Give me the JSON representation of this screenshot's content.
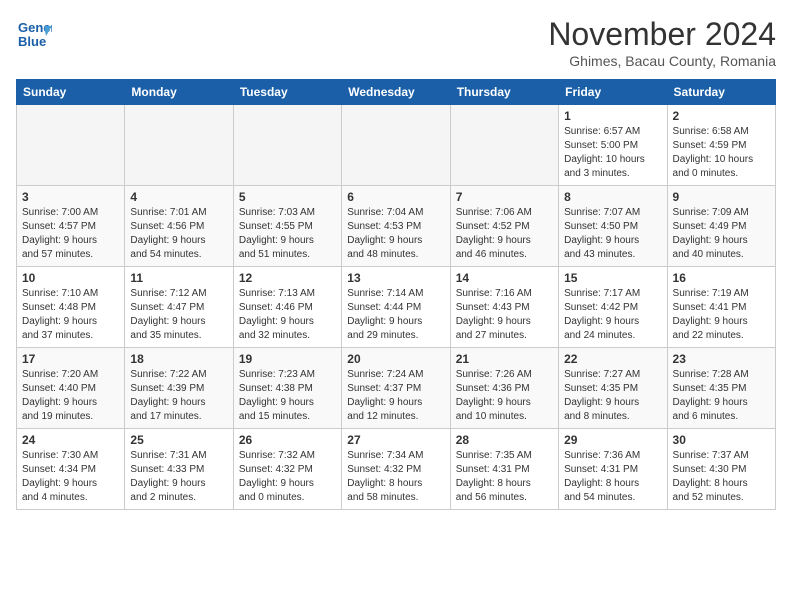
{
  "header": {
    "logo_line1": "General",
    "logo_line2": "Blue",
    "month": "November 2024",
    "location": "Ghimes, Bacau County, Romania"
  },
  "weekdays": [
    "Sunday",
    "Monday",
    "Tuesday",
    "Wednesday",
    "Thursday",
    "Friday",
    "Saturday"
  ],
  "weeks": [
    [
      {
        "day": "",
        "info": ""
      },
      {
        "day": "",
        "info": ""
      },
      {
        "day": "",
        "info": ""
      },
      {
        "day": "",
        "info": ""
      },
      {
        "day": "",
        "info": ""
      },
      {
        "day": "1",
        "info": "Sunrise: 6:57 AM\nSunset: 5:00 PM\nDaylight: 10 hours\nand 3 minutes."
      },
      {
        "day": "2",
        "info": "Sunrise: 6:58 AM\nSunset: 4:59 PM\nDaylight: 10 hours\nand 0 minutes."
      }
    ],
    [
      {
        "day": "3",
        "info": "Sunrise: 7:00 AM\nSunset: 4:57 PM\nDaylight: 9 hours\nand 57 minutes."
      },
      {
        "day": "4",
        "info": "Sunrise: 7:01 AM\nSunset: 4:56 PM\nDaylight: 9 hours\nand 54 minutes."
      },
      {
        "day": "5",
        "info": "Sunrise: 7:03 AM\nSunset: 4:55 PM\nDaylight: 9 hours\nand 51 minutes."
      },
      {
        "day": "6",
        "info": "Sunrise: 7:04 AM\nSunset: 4:53 PM\nDaylight: 9 hours\nand 48 minutes."
      },
      {
        "day": "7",
        "info": "Sunrise: 7:06 AM\nSunset: 4:52 PM\nDaylight: 9 hours\nand 46 minutes."
      },
      {
        "day": "8",
        "info": "Sunrise: 7:07 AM\nSunset: 4:50 PM\nDaylight: 9 hours\nand 43 minutes."
      },
      {
        "day": "9",
        "info": "Sunrise: 7:09 AM\nSunset: 4:49 PM\nDaylight: 9 hours\nand 40 minutes."
      }
    ],
    [
      {
        "day": "10",
        "info": "Sunrise: 7:10 AM\nSunset: 4:48 PM\nDaylight: 9 hours\nand 37 minutes."
      },
      {
        "day": "11",
        "info": "Sunrise: 7:12 AM\nSunset: 4:47 PM\nDaylight: 9 hours\nand 35 minutes."
      },
      {
        "day": "12",
        "info": "Sunrise: 7:13 AM\nSunset: 4:46 PM\nDaylight: 9 hours\nand 32 minutes."
      },
      {
        "day": "13",
        "info": "Sunrise: 7:14 AM\nSunset: 4:44 PM\nDaylight: 9 hours\nand 29 minutes."
      },
      {
        "day": "14",
        "info": "Sunrise: 7:16 AM\nSunset: 4:43 PM\nDaylight: 9 hours\nand 27 minutes."
      },
      {
        "day": "15",
        "info": "Sunrise: 7:17 AM\nSunset: 4:42 PM\nDaylight: 9 hours\nand 24 minutes."
      },
      {
        "day": "16",
        "info": "Sunrise: 7:19 AM\nSunset: 4:41 PM\nDaylight: 9 hours\nand 22 minutes."
      }
    ],
    [
      {
        "day": "17",
        "info": "Sunrise: 7:20 AM\nSunset: 4:40 PM\nDaylight: 9 hours\nand 19 minutes."
      },
      {
        "day": "18",
        "info": "Sunrise: 7:22 AM\nSunset: 4:39 PM\nDaylight: 9 hours\nand 17 minutes."
      },
      {
        "day": "19",
        "info": "Sunrise: 7:23 AM\nSunset: 4:38 PM\nDaylight: 9 hours\nand 15 minutes."
      },
      {
        "day": "20",
        "info": "Sunrise: 7:24 AM\nSunset: 4:37 PM\nDaylight: 9 hours\nand 12 minutes."
      },
      {
        "day": "21",
        "info": "Sunrise: 7:26 AM\nSunset: 4:36 PM\nDaylight: 9 hours\nand 10 minutes."
      },
      {
        "day": "22",
        "info": "Sunrise: 7:27 AM\nSunset: 4:35 PM\nDaylight: 9 hours\nand 8 minutes."
      },
      {
        "day": "23",
        "info": "Sunrise: 7:28 AM\nSunset: 4:35 PM\nDaylight: 9 hours\nand 6 minutes."
      }
    ],
    [
      {
        "day": "24",
        "info": "Sunrise: 7:30 AM\nSunset: 4:34 PM\nDaylight: 9 hours\nand 4 minutes."
      },
      {
        "day": "25",
        "info": "Sunrise: 7:31 AM\nSunset: 4:33 PM\nDaylight: 9 hours\nand 2 minutes."
      },
      {
        "day": "26",
        "info": "Sunrise: 7:32 AM\nSunset: 4:32 PM\nDaylight: 9 hours\nand 0 minutes."
      },
      {
        "day": "27",
        "info": "Sunrise: 7:34 AM\nSunset: 4:32 PM\nDaylight: 8 hours\nand 58 minutes."
      },
      {
        "day": "28",
        "info": "Sunrise: 7:35 AM\nSunset: 4:31 PM\nDaylight: 8 hours\nand 56 minutes."
      },
      {
        "day": "29",
        "info": "Sunrise: 7:36 AM\nSunset: 4:31 PM\nDaylight: 8 hours\nand 54 minutes."
      },
      {
        "day": "30",
        "info": "Sunrise: 7:37 AM\nSunset: 4:30 PM\nDaylight: 8 hours\nand 52 minutes."
      }
    ]
  ]
}
